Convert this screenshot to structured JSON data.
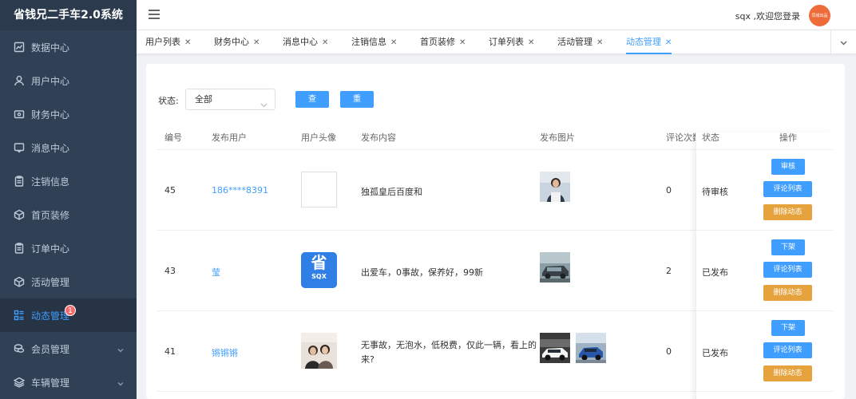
{
  "brand": "省钱兄二手车2.0系统",
  "sidebar": {
    "items": [
      {
        "label": "数据中心",
        "icon": "chart-icon"
      },
      {
        "label": "用户中心",
        "icon": "user-icon"
      },
      {
        "label": "财务中心",
        "icon": "wallet-icon"
      },
      {
        "label": "消息中心",
        "icon": "message-icon"
      },
      {
        "label": "注销信息",
        "icon": "clipboard-icon"
      },
      {
        "label": "首页装修",
        "icon": "cube-icon"
      },
      {
        "label": "订单中心",
        "icon": "clipboard-icon"
      },
      {
        "label": "活动管理",
        "icon": "cube-icon"
      },
      {
        "label": "动态管理",
        "icon": "list-icon",
        "badge": "1",
        "active": true
      },
      {
        "label": "会员管理",
        "icon": "coins-icon",
        "expandable": true
      },
      {
        "label": "车辆管理",
        "icon": "layers-icon",
        "expandable": true
      }
    ]
  },
  "header": {
    "welcome": "sqx ,欢迎您登录",
    "avatar_text": "同城出品"
  },
  "tabs": [
    {
      "label": "用户列表"
    },
    {
      "label": "财务中心"
    },
    {
      "label": "消息中心"
    },
    {
      "label": "注销信息"
    },
    {
      "label": "首页装修"
    },
    {
      "label": "订单列表"
    },
    {
      "label": "活动管理"
    },
    {
      "label": "动态管理",
      "active": true
    }
  ],
  "filter": {
    "label": "状态:",
    "select_value": "全部",
    "query_label": "查询",
    "reset_label": "重置"
  },
  "table": {
    "headers": [
      "编号",
      "发布用户",
      "用户头像",
      "发布内容",
      "发布图片",
      "评论次数",
      "状态",
      "操作"
    ],
    "rows": [
      {
        "id": "45",
        "user": "186****8391",
        "content": "独孤皇后百度和",
        "comments": "0",
        "status": "待审核",
        "actions": [
          "审核",
          "评论列表",
          "删除动态"
        ]
      },
      {
        "id": "43",
        "user": "莹",
        "avatar_text": "省",
        "avatar_sub": "SQX",
        "content": "出爱车，0事故，保养好，99新",
        "comments": "2",
        "status": "已发布",
        "actions": [
          "下架",
          "评论列表",
          "删除动态"
        ]
      },
      {
        "id": "41",
        "user": "锵锵锵",
        "content_line1": "无事故，无泡水，低税费，仅此一辆，看上的",
        "content_line2": "来?",
        "comments": "0",
        "status": "已发布",
        "actions": [
          "下架",
          "评论列表",
          "删除动态"
        ]
      }
    ]
  },
  "colors": {
    "sidebar_bg": "#304156",
    "primary": "#409eff",
    "warning": "#e6a23c",
    "badge": "#f56c6c"
  }
}
